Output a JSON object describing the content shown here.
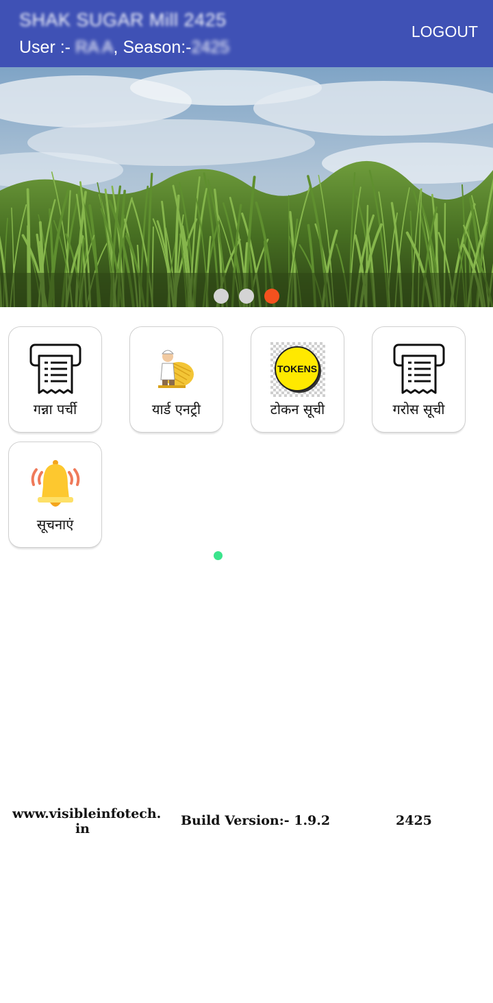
{
  "appbar": {
    "title": "SHAK SUGAR Mill 2425",
    "subtitle_prefix": "User :- ",
    "user_masked": "RA A",
    "season_label": ", Season:-",
    "season_masked": "2425",
    "logout_label": "LOGOUT"
  },
  "banner": {
    "image": "sugarcane-field-photo",
    "slide_count": 3,
    "active_slide": 3
  },
  "tiles": [
    {
      "label": "गन्ना पर्ची",
      "icon": "receipt-icon"
    },
    {
      "label": "यार्ड एनट्री",
      "icon": "farmer-icon"
    },
    {
      "label": "टोकन सूची",
      "icon": "tokens-icon",
      "icon_text": "TOKENS"
    },
    {
      "label": "गरोस सूची",
      "icon": "receipt-icon"
    },
    {
      "label": "सूचनाएं",
      "icon": "bell-icon"
    }
  ],
  "footer": {
    "website_line1": "www.visibleinfotech.",
    "website_line2": "in",
    "build_version": "Build Version:- 1.9.2",
    "season_code": "2425"
  },
  "colors": {
    "appbar": "#3f51b5",
    "active_dot": "#f4511e",
    "inactive_dot": "#d4d4d4",
    "status_dot": "#3be48c"
  }
}
